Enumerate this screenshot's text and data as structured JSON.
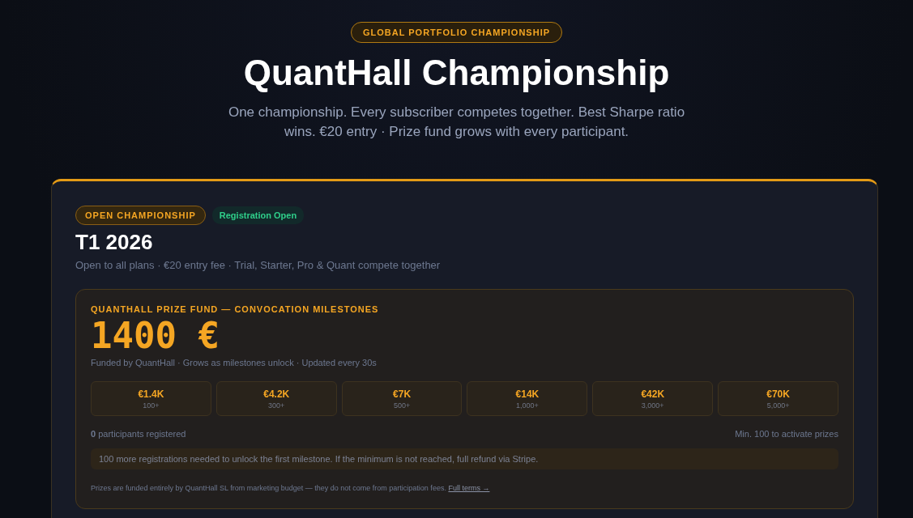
{
  "header": {
    "eyebrow": "GLOBAL PORTFOLIO CHAMPIONSHIP",
    "title": "QuantHall Championship",
    "subtitle": "One championship. Every subscriber competes together. Best Sharpe ratio wins. €20 entry · Prize fund grows with every participant."
  },
  "championship": {
    "badge": "OPEN CHAMPIONSHIP",
    "status": "Registration Open",
    "title": "T1 2026",
    "description": "Open to all plans · €20 entry fee · Trial, Starter, Pro & Quant compete together",
    "prize_fund": {
      "label": "QUANTHALL PRIZE FUND — CONVOCATION MILESTONES",
      "amount": "1400 €",
      "note": "Funded by QuantHall · Grows as milestones unlock · Updated every 30s",
      "milestones": [
        {
          "prize": "€1.4K",
          "threshold": "100+"
        },
        {
          "prize": "€4.2K",
          "threshold": "300+"
        },
        {
          "prize": "€7K",
          "threshold": "500+"
        },
        {
          "prize": "€14K",
          "threshold": "1,000+"
        },
        {
          "prize": "€42K",
          "threshold": "3,000+"
        },
        {
          "prize": "€70K",
          "threshold": "5,000+"
        }
      ],
      "participants": "**0** participants registered",
      "minimum": "Min. 100 to activate prizes",
      "notice": "100 more registrations needed to unlock the first milestone. If the minimum is not reached, full refund via Stripe.",
      "disclaimer": "Prizes are funded entirely by QuantHall SL from marketing budget — they do not come from participation fees.",
      "terms_link": "Full terms →"
    }
  }
}
